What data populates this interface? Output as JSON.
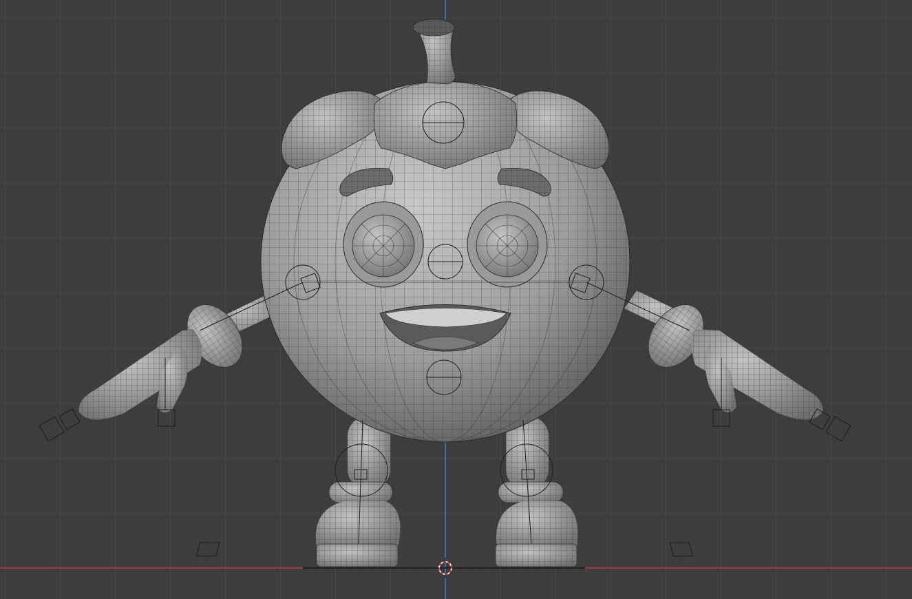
{
  "viewport": {
    "background": "#3d3d3d",
    "grid_minor": "#444444",
    "grid_major": "#4a4a4a",
    "axis_x_color": "#c0393e",
    "axis_z_color": "#4a78c4",
    "mesh_fill": "#8a8a8a",
    "mesh_wire": "#2a2a2a",
    "rig_line": "#1c1c1c",
    "cursor_colors": [
      "#e04040",
      "#ffffff"
    ]
  },
  "model": {
    "object": "pumpkin-character",
    "shading": "solid-with-wireframe",
    "parts": [
      "body",
      "stem",
      "leaves",
      "eyebrows",
      "eyes",
      "mouth",
      "arms",
      "hands",
      "legs",
      "boots"
    ],
    "rig_controls_visible": true
  }
}
